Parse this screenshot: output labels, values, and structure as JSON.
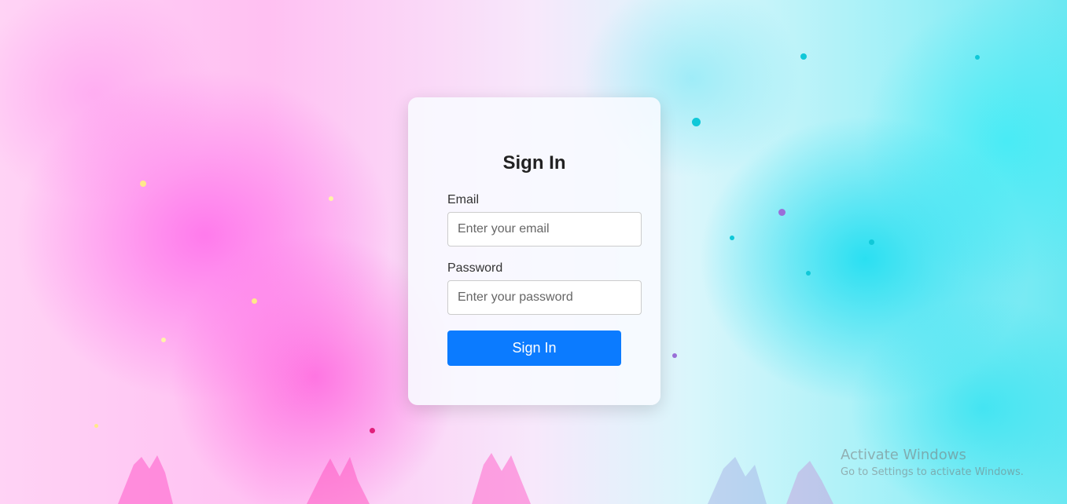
{
  "login_card": {
    "title": "Sign In",
    "email": {
      "label": "Email",
      "placeholder": "Enter your email",
      "value": ""
    },
    "password": {
      "label": "Password",
      "placeholder": "Enter your password",
      "value": ""
    },
    "submit_label": "Sign In"
  },
  "watermark": {
    "title": "Activate Windows",
    "subtitle": "Go to Settings to activate Windows."
  },
  "colors": {
    "primary_button": "#0b7bff",
    "background_left": "#ff6eeb",
    "background_right": "#14dcf0"
  }
}
